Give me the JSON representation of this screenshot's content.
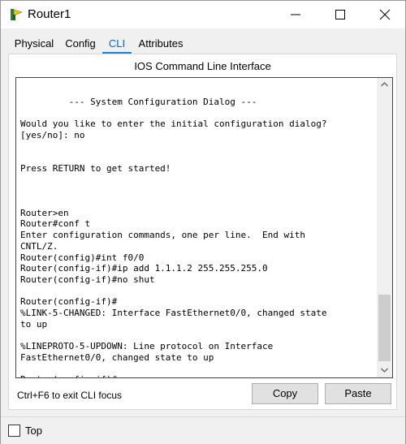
{
  "window": {
    "title": "Router1",
    "icon": "router-app-icon",
    "controls": [
      "minimize-icon",
      "maximize-icon",
      "close-icon"
    ]
  },
  "tabs": [
    {
      "label": "Physical",
      "active": false
    },
    {
      "label": "Config",
      "active": false
    },
    {
      "label": "CLI",
      "active": true
    },
    {
      "label": "Attributes",
      "active": false
    }
  ],
  "cli": {
    "heading": "IOS Command Line Interface",
    "output_lines": [
      "",
      "         --- System Configuration Dialog ---",
      "",
      "Would you like to enter the initial configuration dialog?",
      "[yes/no]: no",
      "",
      "",
      "Press RETURN to get started!",
      "",
      "",
      "",
      "Router>en",
      "Router#conf t",
      "Enter configuration commands, one per line.  End with",
      "CNTL/Z.",
      "Router(config)#int f0/0",
      "Router(config-if)#ip add 1.1.1.2 255.255.255.0",
      "Router(config-if)#no shut",
      "",
      "Router(config-if)#",
      "%LINK-5-CHANGED: Interface FastEthernet0/0, changed state",
      "to up",
      "",
      "%LINEPROTO-5-UPDOWN: Line protocol on Interface",
      "FastEthernet0/0, changed state to up",
      "",
      "Router(config-if)#"
    ],
    "output_text": "\n         --- System Configuration Dialog ---\n\nWould you like to enter the initial configuration dialog?\n[yes/no]: no\n\n\nPress RETURN to get started!\n\n\n\nRouter>en\nRouter#conf t\nEnter configuration commands, one per line.  End with\nCNTL/Z.\nRouter(config)#int f0/0\nRouter(config-if)#ip add 1.1.1.2 255.255.255.0\nRouter(config-if)#no shut\n\nRouter(config-if)#\n%LINK-5-CHANGED: Interface FastEthernet0/0, changed state\nto up\n\n%LINEPROTO-5-UPDOWN: Line protocol on Interface\nFastEthernet0/0, changed state to up\n\nRouter(config-if)#",
    "scroll_position": "bottom",
    "focus_hint": "Ctrl+F6 to exit CLI focus",
    "copy_label": "Copy",
    "paste_label": "Paste"
  },
  "footer": {
    "top_checkbox_label": "Top",
    "top_checked": false
  },
  "colors": {
    "active_tab_text": "#0a64c8",
    "active_tab_underline": "#1d86d6",
    "background": "#f0f0f0"
  }
}
